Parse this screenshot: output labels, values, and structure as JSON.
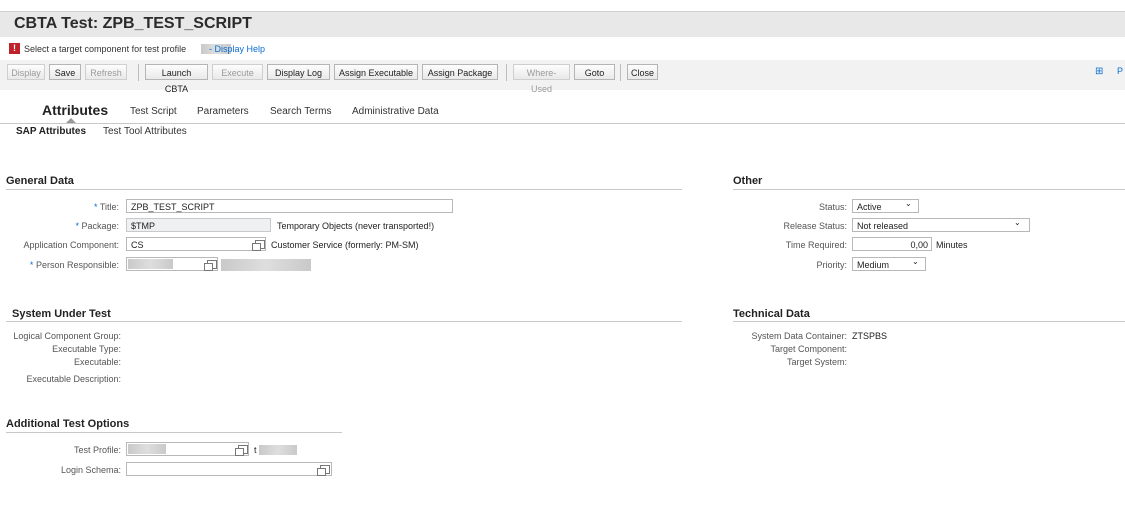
{
  "page": {
    "title": "CBTA Test: ZPB_TEST_SCRIPT"
  },
  "message": {
    "icon": "error-icon",
    "icon_glyph": "!",
    "text": "Select a target component for test profile",
    "help_link": "- Display Help"
  },
  "toolbar": {
    "display": "Display",
    "save": "Save",
    "refresh": "Refresh",
    "launch_cbta": "Launch CBTA",
    "execute": "Execute",
    "display_log": "Display Log",
    "assign_executable": "Assign Executable",
    "assign_package": "Assign Package",
    "where_used": "Where-Used",
    "goto": "Goto",
    "close": "Close",
    "right_link_suffix": "P"
  },
  "tabs": [
    "Attributes",
    "Test Script",
    "Parameters",
    "Search Terms",
    "Administrative Data"
  ],
  "subtabs": [
    "SAP Attributes",
    "Test Tool Attributes"
  ],
  "general": {
    "heading": "General Data",
    "title_label": "Title:",
    "title_value": "ZPB_TEST_SCRIPT",
    "package_label": "Package:",
    "package_value": "$TMP",
    "package_desc": "Temporary Objects (never transported!)",
    "app_comp_label": "Application Component:",
    "app_comp_value": "CS",
    "app_comp_desc": "Customer Service (formerly: PM-SM)",
    "person_label": "Person Responsible:",
    "required_mark": "*"
  },
  "other": {
    "heading": "Other",
    "status_label": "Status:",
    "status_value": "Active",
    "release_label": "Release Status:",
    "release_value": "Not released",
    "time_label": "Time Required:",
    "time_value": "0,00",
    "time_unit": "Minutes",
    "priority_label": "Priority:",
    "priority_value": "Medium",
    "dropdown_glyph": "⌄"
  },
  "sut": {
    "heading": "System Under Test",
    "lcg_label": "Logical Component Group:",
    "exe_type_label": "Executable Type:",
    "exe_label": "Executable:",
    "exe_desc_label": "Executable Description:"
  },
  "tech": {
    "heading": "Technical Data",
    "sdc_label": "System Data Container:",
    "sdc_value": "ZTSPBS",
    "target_comp_label": "Target Component:",
    "target_sys_label": "Target System:"
  },
  "ato": {
    "heading": "Additional Test Options",
    "profile_label": "Test Profile:",
    "profile_desc_prefix": "t",
    "login_label": "Login Schema:"
  },
  "colors": {
    "accent": "#0a6ed1",
    "error": "#c0222a",
    "titlebar": "#e8e8e8"
  }
}
